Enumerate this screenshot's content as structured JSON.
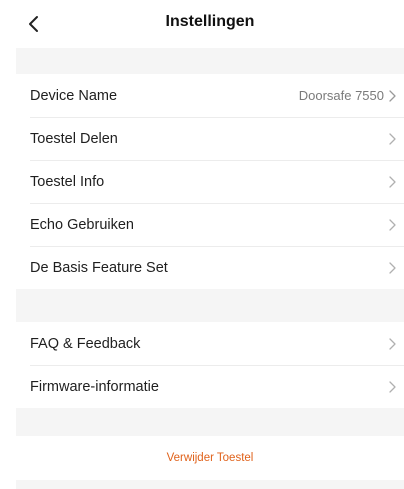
{
  "header": {
    "back_icon": "chevron-left-icon",
    "title": "Instellingen"
  },
  "group_device": {
    "items": [
      {
        "label": "Device Name",
        "value": "Doorsafe 7550",
        "icon": "chevron-right-icon"
      },
      {
        "label": "Toestel Delen",
        "icon": "chevron-right-icon"
      },
      {
        "label": "Toestel Info",
        "icon": "chevron-right-icon"
      },
      {
        "label": "Echo Gebruiken",
        "icon": "chevron-right-icon"
      },
      {
        "label": "De Basis Feature Set",
        "icon": "chevron-right-icon"
      }
    ]
  },
  "group_support": {
    "items": [
      {
        "label": "FAQ & Feedback",
        "icon": "chevron-right-icon"
      },
      {
        "label": "Firmware-informatie",
        "icon": "chevron-right-icon"
      }
    ]
  },
  "actions": {
    "delete_label": "Verwijder Toestel"
  },
  "colors": {
    "background": "#f5f5f5",
    "surface": "#ffffff",
    "accent_danger": "#e0621b",
    "secondary_text": "#7a7a7a",
    "chevron": "#b0b0b0"
  }
}
